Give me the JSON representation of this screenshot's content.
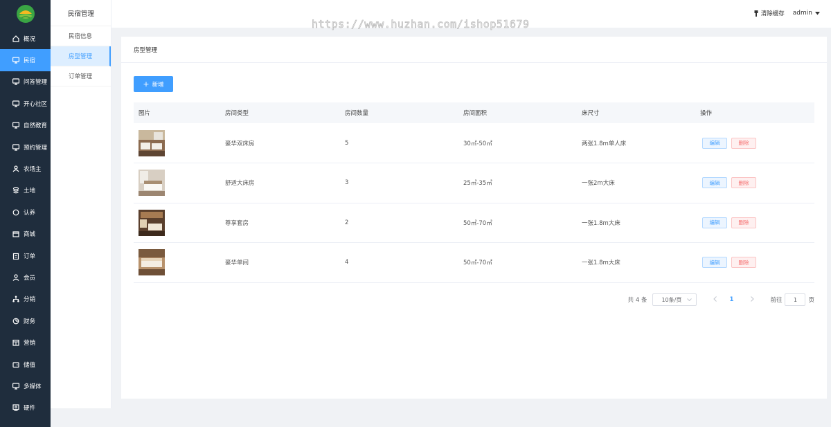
{
  "sidebar": {
    "items": [
      {
        "label": "概况",
        "icon": "home-icon"
      },
      {
        "label": "民宿",
        "icon": "monitor-icon"
      },
      {
        "label": "问答管理",
        "icon": "monitor-icon"
      },
      {
        "label": "开心社区",
        "icon": "monitor-icon"
      },
      {
        "label": "自然教育",
        "icon": "monitor-icon"
      },
      {
        "label": "预约管理",
        "icon": "monitor-icon"
      },
      {
        "label": "农场主",
        "icon": "user-group-icon"
      },
      {
        "label": "土地",
        "icon": "stack-icon"
      },
      {
        "label": "认养",
        "icon": "circle-icon"
      },
      {
        "label": "商城",
        "icon": "shop-icon"
      },
      {
        "label": "订单",
        "icon": "clipboard-icon"
      },
      {
        "label": "会员",
        "icon": "user-icon"
      },
      {
        "label": "分销",
        "icon": "network-icon"
      },
      {
        "label": "财务",
        "icon": "pie-icon"
      },
      {
        "label": "营销",
        "icon": "calendar-icon"
      },
      {
        "label": "储值",
        "icon": "wallet-icon"
      },
      {
        "label": "多媒体",
        "icon": "monitor-icon"
      },
      {
        "label": "硬件",
        "icon": "device-icon"
      }
    ],
    "active_index": 1
  },
  "submenu": {
    "title": "民宿管理",
    "items": [
      "民宿信息",
      "房型管理",
      "订单管理"
    ],
    "active_index": 1
  },
  "topbar": {
    "watermark": "https://www.huzhan.com/ishop51679",
    "clear_cache": "清除缓存",
    "user": "admin"
  },
  "card": {
    "title": "房型管理",
    "add_label": "新增"
  },
  "table": {
    "headers": [
      "图片",
      "房间类型",
      "房间数量",
      "房间面积",
      "床尺寸",
      "操作"
    ],
    "rows": [
      {
        "type": "豪华双床房",
        "count": "5",
        "area": "30㎡-50㎡",
        "bed": "两张1.8m单人床",
        "photo": "bedroom-photo-twin"
      },
      {
        "type": "舒适大床房",
        "count": "3",
        "area": "25㎡-35㎡",
        "bed": "一张2m大床",
        "photo": "bedroom-photo-king"
      },
      {
        "type": "尊享套房",
        "count": "2",
        "area": "50㎡-70㎡",
        "bed": "一张1.8m大床",
        "photo": "bedroom-photo-suite"
      },
      {
        "type": "豪华单间",
        "count": "4",
        "area": "50㎡-70㎡",
        "bed": "一张1.8m大床",
        "photo": "bedroom-photo-single"
      }
    ],
    "edit_label": "编辑",
    "delete_label": "删除"
  },
  "pagination": {
    "total": "共 4 条",
    "page_size": "10条/页",
    "current": "1",
    "goto_prefix": "前往",
    "goto_value": "1",
    "goto_suffix": "页"
  },
  "colors": {
    "sidebar_bg": "#1f2d3d",
    "accent": "#409eff",
    "danger": "#f56c6c"
  }
}
